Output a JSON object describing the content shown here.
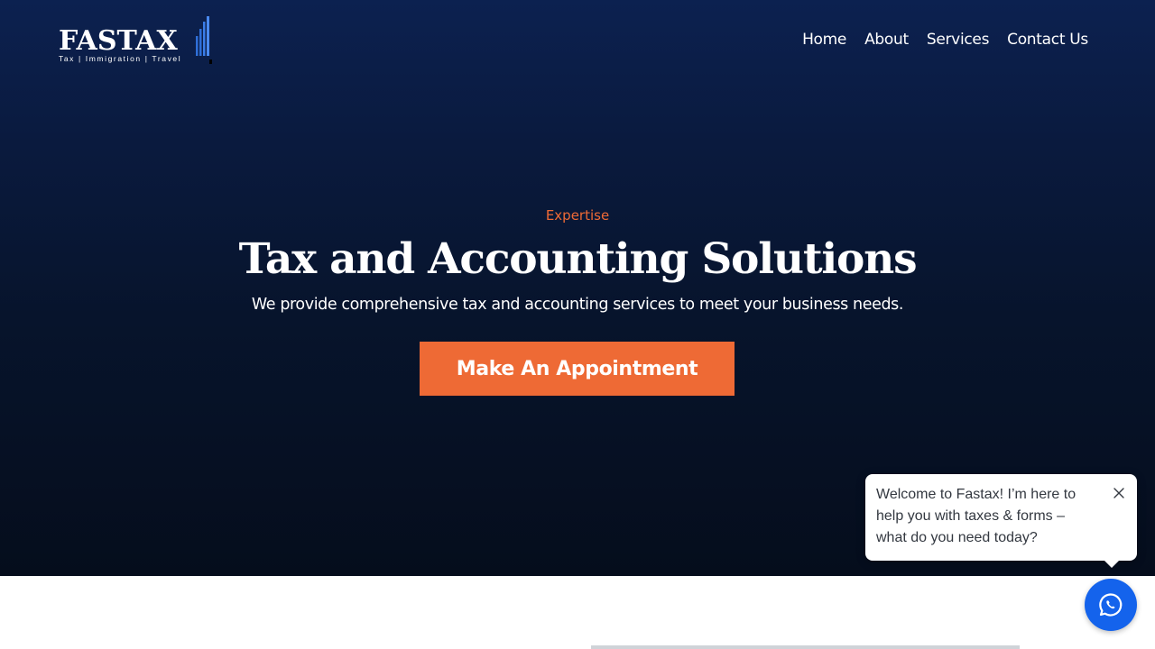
{
  "brand": {
    "name": "FASTAX",
    "tagline": "Tax | Immigration | Travel",
    "icon": "bar-chart-icon",
    "accent_color": "#ee6a35",
    "primary_bg": "#0a1a3e"
  },
  "nav": {
    "items": [
      {
        "label": "Home"
      },
      {
        "label": "About"
      },
      {
        "label": "Services"
      },
      {
        "label": "Contact Us"
      }
    ]
  },
  "hero": {
    "eyebrow": "Expertise",
    "title": "Tax and Accounting Solutions",
    "subtitle": "We provide comprehensive tax and accounting services to meet your business needs.",
    "cta_label": "Make An Appointment"
  },
  "chat": {
    "message": "Welcome to Fastax! I’m here to help you with taxes & forms – what do you need today?",
    "close_icon": "close-icon",
    "fab_icon": "whatsapp-icon",
    "fab_color": "#1463ec"
  }
}
